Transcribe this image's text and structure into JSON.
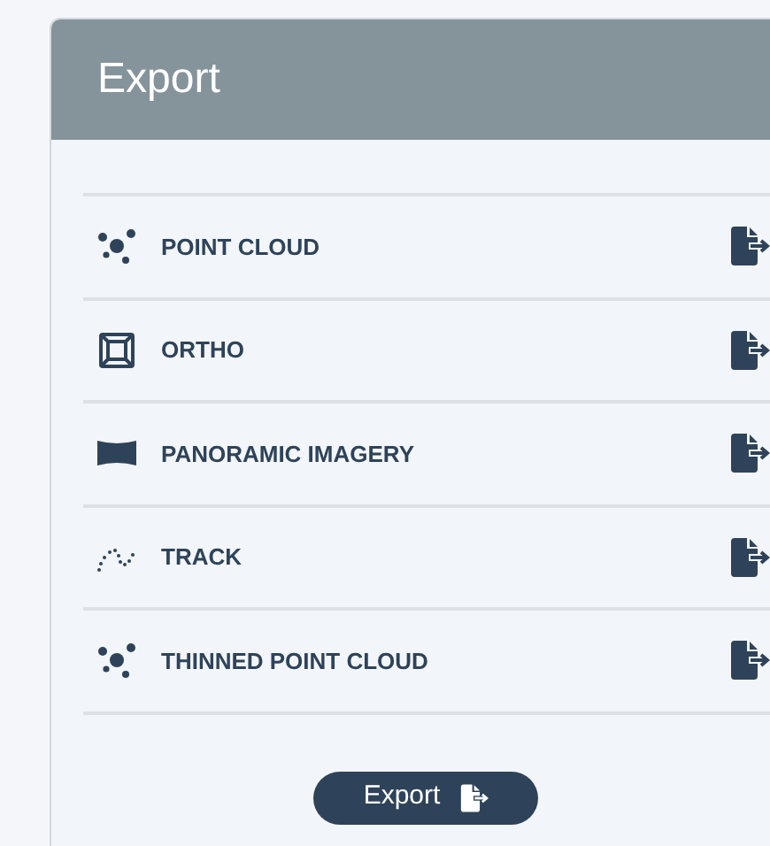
{
  "panel": {
    "title": "Export"
  },
  "items": [
    {
      "kind": "point-cloud",
      "label": "POINT CLOUD"
    },
    {
      "kind": "ortho",
      "label": "ORTHO"
    },
    {
      "kind": "panorama",
      "label": "PANORAMIC IMAGERY"
    },
    {
      "kind": "track",
      "label": "TRACK"
    },
    {
      "kind": "point-cloud",
      "label": "THINNED POINT CLOUD"
    }
  ],
  "button": {
    "label": "Export"
  }
}
